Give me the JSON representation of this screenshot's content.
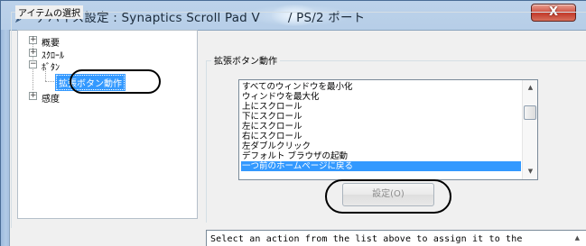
{
  "window": {
    "title": "デバイス設定 : Synaptics Scroll Pad V",
    "title_suffix": "/ PS/2 ポート",
    "close_label": "X",
    "icon": "pen-icon"
  },
  "item_select": {
    "legend": "アイテムの選択",
    "tree": [
      {
        "label": "概要",
        "expander": "+"
      },
      {
        "label": "ｽｸﾛｰﾙ",
        "expander": "+"
      },
      {
        "label": "ﾎﾞﾀﾝ",
        "expander": "−"
      },
      {
        "label": "拡張ボタン動作",
        "expander": "",
        "selected": true
      },
      {
        "label": "感度",
        "expander": "+"
      }
    ]
  },
  "extended_button": {
    "legend": "拡張ボタン動作",
    "list_items": [
      "すべてのウィンドウを最小化",
      "ウィンドウを最大化",
      "上にスクロール",
      "下にスクロール",
      "左にスクロール",
      "右にスクロール",
      "左ダブルクリック",
      "デフォルト ブラウザの起動",
      "一つ前のホームページに戻る"
    ],
    "selected_index": 8,
    "set_button": "設定(O)"
  },
  "description": "Select an action from the list above to assign it to the",
  "colors": {
    "selection": "#3399ff",
    "window_frame": "#a9c4e2",
    "close_button": "#c23a2b"
  }
}
